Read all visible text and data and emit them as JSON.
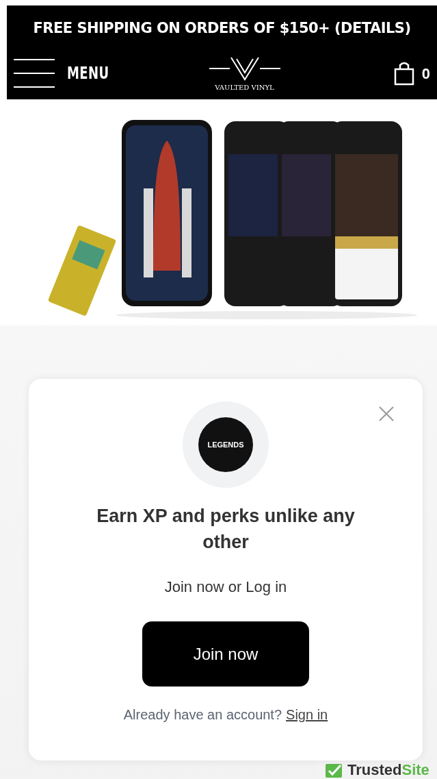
{
  "announcement": "FREE SHIPPING ON ORDERS OF $150+ (DETAILS)",
  "header": {
    "menu_label": "MENU",
    "logo_text": "VAULTED VINYL",
    "cart_count": "0"
  },
  "modal": {
    "badge_text": "LEGENDS",
    "title": "Earn XP and perks unlike any other",
    "subtitle": "Join now or Log in",
    "join_button": "Join now",
    "signin_prompt": "Already have an account?",
    "signin_link": "Sign in"
  },
  "trust_badge": {
    "label_dark": "Trusted",
    "label_green": "Site"
  }
}
